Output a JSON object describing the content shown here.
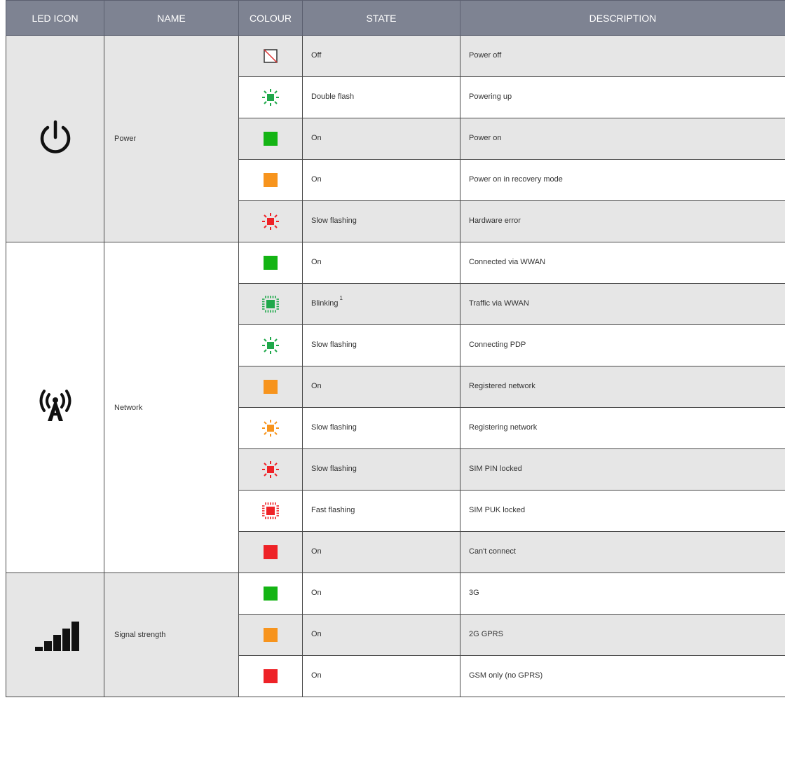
{
  "header": {
    "led_icon": "LED ICON",
    "name": "NAME",
    "colour": "COLOUR",
    "state": "STATE",
    "description": "DESCRIPTION"
  },
  "groups": [
    {
      "name": "Power",
      "icon": "power-icon",
      "rows": [
        {
          "led": "off",
          "color": "#ffffff",
          "state": "Off",
          "description": "Power off"
        },
        {
          "led": "flash",
          "color": "#1fa84a",
          "state": "Double flash",
          "description": "Powering up"
        },
        {
          "led": "solid",
          "color": "#14b414",
          "state": "On",
          "description": "Power on"
        },
        {
          "led": "solid",
          "color": "#f7941d",
          "state": "On",
          "description": "Power on in recovery mode"
        },
        {
          "led": "flash",
          "color": "#ee2227",
          "state": "Slow flashing",
          "description": "Hardware error"
        }
      ]
    },
    {
      "name": "Network",
      "icon": "network-tower-icon",
      "rows": [
        {
          "led": "solid",
          "color": "#14b414",
          "state": "On",
          "description": "Connected via WWAN"
        },
        {
          "led": "blink",
          "color": "#1fa84a",
          "state": "Blinking",
          "state_sup": "1",
          "description": "Traffic via WWAN"
        },
        {
          "led": "flash",
          "color": "#1fa84a",
          "state": "Slow flashing",
          "description": "Connecting PDP"
        },
        {
          "led": "solid",
          "color": "#f7941d",
          "state": "On",
          "description": "Registered network"
        },
        {
          "led": "flash",
          "color": "#f7941d",
          "state": "Slow flashing",
          "description": "Registering network"
        },
        {
          "led": "flash",
          "color": "#ee2227",
          "state": "Slow flashing",
          "description": "SIM PIN locked"
        },
        {
          "led": "blink",
          "color": "#ee2227",
          "state": "Fast flashing",
          "description": "SIM PUK locked"
        },
        {
          "led": "solid",
          "color": "#ee2227",
          "state": "On",
          "description": "Can't connect"
        }
      ]
    },
    {
      "name": "Signal strength",
      "icon": "signal-strength-icon",
      "rows": [
        {
          "led": "solid",
          "color": "#14b414",
          "state": "On",
          "description": "3G"
        },
        {
          "led": "solid",
          "color": "#f7941d",
          "state": "On",
          "description": "2G GPRS"
        },
        {
          "led": "solid",
          "color": "#ee2227",
          "state": "On",
          "description": "GSM only (no GPRS)"
        }
      ]
    }
  ]
}
